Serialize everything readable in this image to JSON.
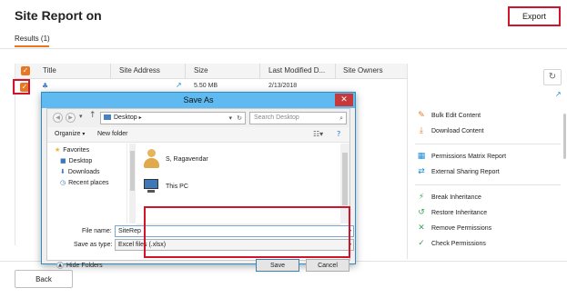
{
  "header": {
    "title": "Site Report on",
    "export_label": "Export"
  },
  "tabs": [
    {
      "label": "Results (1)"
    }
  ],
  "table": {
    "columns": [
      "Title",
      "Site Address",
      "Size",
      "Last Modified D...",
      "Site Owners"
    ],
    "rows": [
      {
        "title": "",
        "site_address": "",
        "size": "5.50 MB",
        "last_modified": "2/13/2018",
        "site_owners": ""
      }
    ]
  },
  "right_panel": {
    "groups": [
      [
        {
          "label": "Bulk Edit Content",
          "icon": "edit-icon"
        },
        {
          "label": "Download Content",
          "icon": "download-icon"
        }
      ],
      [
        {
          "label": "Permissions Matrix Report",
          "icon": "matrix-icon"
        },
        {
          "label": "External Sharing Report",
          "icon": "sharing-icon"
        }
      ],
      [
        {
          "label": "Break Inheritance",
          "icon": "break-icon"
        },
        {
          "label": "Restore Inheritance",
          "icon": "restore-icon"
        },
        {
          "label": "Remove Permissions",
          "icon": "remove-icon"
        },
        {
          "label": "Check Permissions",
          "icon": "check-icon"
        }
      ]
    ]
  },
  "footer": {
    "back_label": "Back"
  },
  "dialog": {
    "title": "Save As",
    "address": "Desktop",
    "search_placeholder": "Search Desktop",
    "toolbar": {
      "organize": "Organize",
      "new_folder": "New folder"
    },
    "nav_pane": [
      "Favorites",
      "Desktop",
      "Downloads",
      "Recent places"
    ],
    "content_items": [
      {
        "label": "S, Ragavendar",
        "icon": "user-folder-icon"
      },
      {
        "label": "This PC",
        "icon": "computer-icon"
      }
    ],
    "file_name_label": "File name:",
    "file_name_value": "SiteRep",
    "save_type_label": "Save as type:",
    "save_type_value": "Excel files (.xlsx)",
    "hide_folders": "Hide Folders",
    "save_label": "Save",
    "cancel_label": "Cancel"
  },
  "colors": {
    "accent": "#e87722",
    "highlight_red": "#d0142c",
    "dialog_titlebar": "#5ebaf0",
    "link_blue": "#1a8cd8"
  }
}
